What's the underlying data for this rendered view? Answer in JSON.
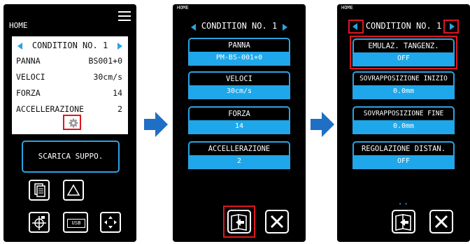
{
  "screen1": {
    "home_label": "HOME",
    "condition_title": "CONDITION NO. 1",
    "rows": [
      {
        "key": "PANNA",
        "value": "BS001+0"
      },
      {
        "key": "VELOCI",
        "value": "30cm/s"
      },
      {
        "key": "FORZA",
        "value": "14"
      },
      {
        "key": "ACCELLERAZIONE",
        "value": "2"
      }
    ],
    "download_button": "SCARICA SUPPO.",
    "usb_label": "USB"
  },
  "screen2": {
    "home_label": "HOME",
    "condition_title": "CONDITION NO. 1",
    "fields": [
      {
        "label": "PANNA",
        "value": "PM-BS-001+0"
      },
      {
        "label": "VELOCI",
        "value": "30cm/s"
      },
      {
        "label": "FORZA",
        "value": "14"
      },
      {
        "label": "ACCELLERAZIONE",
        "value": "2"
      }
    ]
  },
  "screen3": {
    "home_label": "HOME",
    "condition_title": "CONDITION NO. 1",
    "fields": [
      {
        "label": "EMULAZ. TANGENZ.",
        "value": "OFF"
      },
      {
        "label": "SOVRAPPOSIZIONE INIZIO",
        "value": "0.0mm"
      },
      {
        "label": "SOVRAPPOSIZIONE FINE",
        "value": "0.0mm"
      },
      {
        "label": "REGOLAZIONE DISTAN.",
        "value": "OFF"
      }
    ],
    "page_dots": "• •"
  },
  "colors": {
    "accent": "#2aa3e6",
    "highlight": "#e0161f",
    "field_value_bg": "#1ea7ea",
    "flow_arrow": "#1f6fc4"
  },
  "icons": [
    "menu-icon",
    "gear-icon",
    "copy-icon",
    "triangle-icon",
    "crosshair-icon",
    "usb-icon",
    "move-arrows-icon",
    "book-return-icon",
    "close-icon",
    "arrow-left-icon",
    "arrow-right-icon"
  ]
}
